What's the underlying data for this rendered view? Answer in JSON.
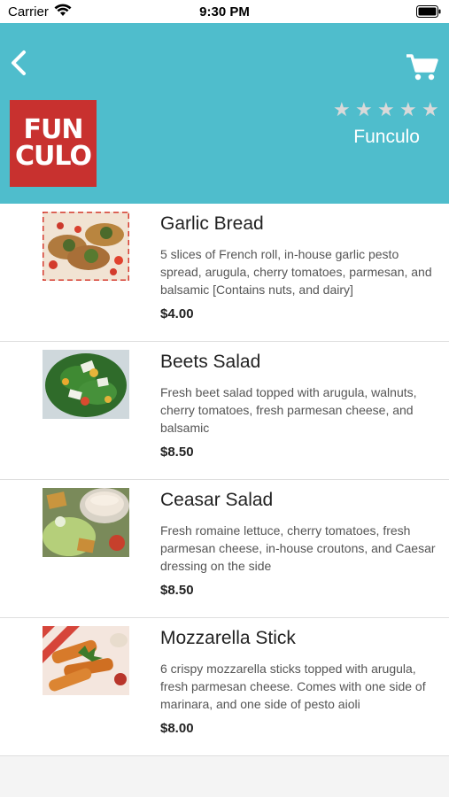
{
  "status_bar": {
    "carrier": "Carrier",
    "time": "9:30 PM",
    "icons": [
      "wifi-icon",
      "battery-icon"
    ]
  },
  "header": {
    "background_color": "#4fbdcc",
    "back_icon": "chevron-left-icon",
    "cart_icon": "cart-icon",
    "logo_text_line1": "FUN",
    "logo_text_line2": "CULO",
    "logo_color": "#c8312f",
    "rating_stars": 5,
    "restaurant_name": "Funculo"
  },
  "menu": {
    "items": [
      {
        "name": "Garlic Bread",
        "description": "5 slices of French roll, in-house garlic pesto spread, arugula, cherry tomatoes, parmesan, and balsamic [Contains nuts, and dairy]",
        "price": "$4.00"
      },
      {
        "name": "Beets Salad",
        "description": "Fresh beet salad topped with arugula, walnuts, cherry tomatoes, fresh parmesan cheese, and balsamic",
        "price": "$8.50"
      },
      {
        "name": "Ceasar Salad",
        "description": "Fresh romaine lettuce, cherry tomatoes, fresh parmesan cheese, in-house croutons, and Caesar dressing on the side",
        "price": "$8.50"
      },
      {
        "name": "Mozzarella Stick",
        "description": "6 crispy mozzarella sticks topped with arugula, fresh parmesan cheese. Comes with one side of marinara, and one side of pesto aioli",
        "price": "$8.00"
      }
    ]
  }
}
